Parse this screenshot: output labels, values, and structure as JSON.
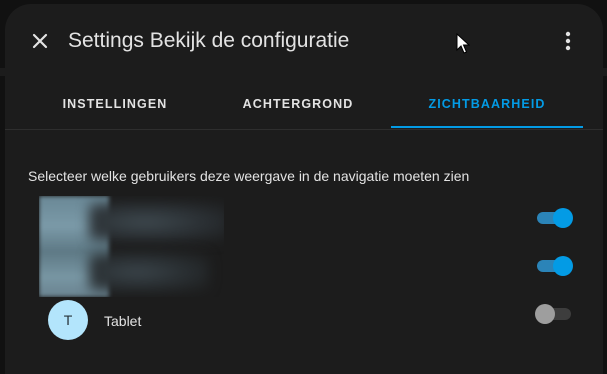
{
  "dialog": {
    "title": "Settings Bekijk de configuratie",
    "close_icon": "close-icon",
    "menu_icon": "more-vertical-icon"
  },
  "tabs": [
    {
      "label": "INSTELLINGEN",
      "active": false
    },
    {
      "label": "ACHTERGROND",
      "active": false
    },
    {
      "label": "ZICHTBAARHEID",
      "active": true
    }
  ],
  "visibility": {
    "description": "Selecteer welke gebruikers deze weergave in de navigatie moeten zien",
    "users": [
      {
        "name": "",
        "initial": "",
        "blurred": true,
        "visible": true
      },
      {
        "name": "",
        "initial": "",
        "blurred": true,
        "visible": true
      },
      {
        "name": "Tablet",
        "initial": "T",
        "blurred": false,
        "visible": false
      }
    ]
  },
  "colors": {
    "accent": "#039be5",
    "surface": "#1c1c1c",
    "text": "#e3e3e3",
    "avatar_bg": "#b3e5fc"
  }
}
